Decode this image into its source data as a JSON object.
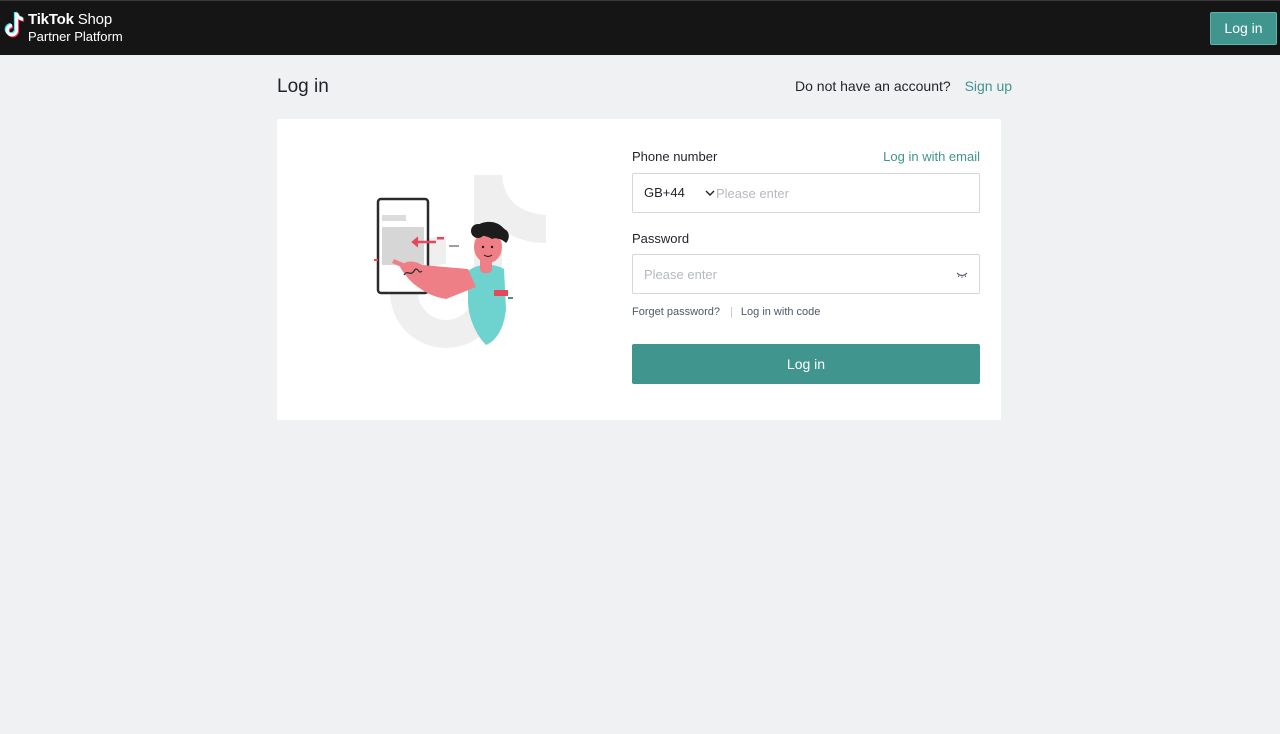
{
  "header": {
    "brand_name": "TikTok",
    "brand_suffix": "Shop",
    "brand_subtitle": "Partner Platform",
    "login_button": "Log in",
    "logo_icon": "tiktok-logo-icon"
  },
  "page": {
    "title": "Log in",
    "no_account_text": "Do not have an account?",
    "signup_link": "Sign up"
  },
  "form": {
    "phone_label": "Phone number",
    "email_login_link": "Log in with email",
    "country_code": "GB+44",
    "phone_placeholder": "Please enter",
    "password_label": "Password",
    "password_placeholder": "Please enter",
    "forget_password_link": "Forget password?",
    "separator": "|",
    "code_login_link": "Log in with code",
    "submit_button": "Log in"
  },
  "colors": {
    "accent": "#40958f",
    "header_bg": "#151515",
    "page_bg": "#f0f1f3"
  }
}
